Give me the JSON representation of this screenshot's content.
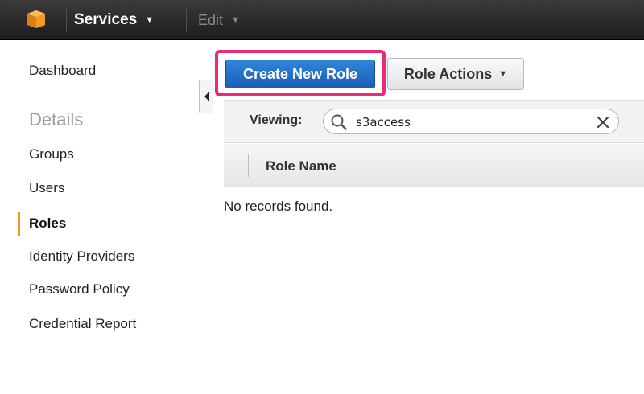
{
  "topbar": {
    "logo_icon": "aws-cube-icon",
    "services_label": "Services",
    "edit_label": "Edit",
    "colors": {
      "background": "#232323",
      "logo": "#f7981d"
    }
  },
  "sidebar": {
    "items": [
      {
        "label": "Dashboard"
      },
      {
        "heading": "Details"
      },
      {
        "label": "Groups"
      },
      {
        "label": "Users"
      },
      {
        "label": "Roles",
        "active": true
      },
      {
        "label": "Identity Providers"
      },
      {
        "label": "Password Policy"
      },
      {
        "label": "Credential Report"
      }
    ],
    "active_color": "#f7981d"
  },
  "toolbar": {
    "create_label": "Create New Role",
    "actions_label": "Role Actions",
    "highlight_color": "#ec2a77",
    "primary_color": "#1f6fc8"
  },
  "filter": {
    "viewing_label": "Viewing:",
    "search_value": "s3access"
  },
  "table": {
    "columns": [
      "Role Name"
    ],
    "empty_message": "No records found."
  }
}
